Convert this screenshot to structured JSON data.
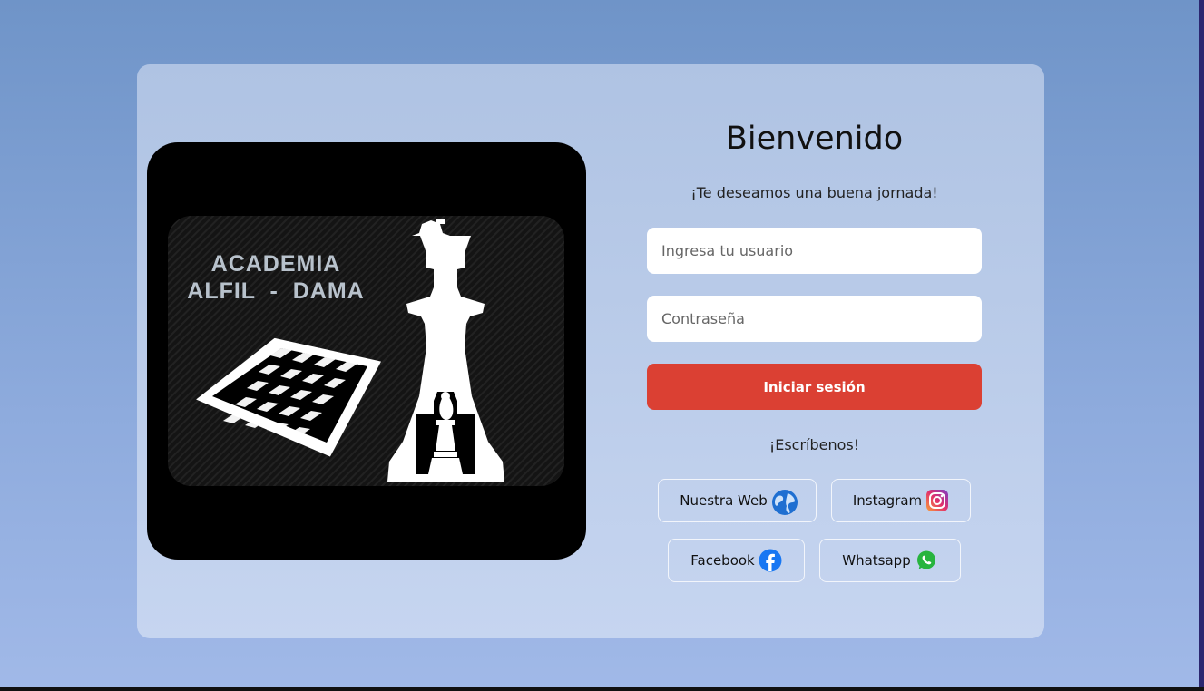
{
  "logo": {
    "line1": "ACADEMIA",
    "line2": "ALFIL  -  DAMA"
  },
  "login": {
    "title": "Bienvenido",
    "subtitle": "¡Te deseamos una buena jornada!",
    "username_placeholder": "Ingresa tu usuario",
    "password_placeholder": "Contraseña",
    "submit_label": "Iniciar sesión",
    "contact_heading": "¡Escríbenos!"
  },
  "social": {
    "web": {
      "label": "Nuestra Web",
      "icon": "globe-icon"
    },
    "instagram": {
      "label": "Instagram",
      "icon": "instagram-icon"
    },
    "facebook": {
      "label": "Facebook",
      "icon": "facebook-icon"
    },
    "whatsapp": {
      "label": "Whatsapp",
      "icon": "whatsapp-icon"
    }
  },
  "colors": {
    "accent": "#db4033",
    "background": "#7b9dd2",
    "card": "#bccce9"
  }
}
